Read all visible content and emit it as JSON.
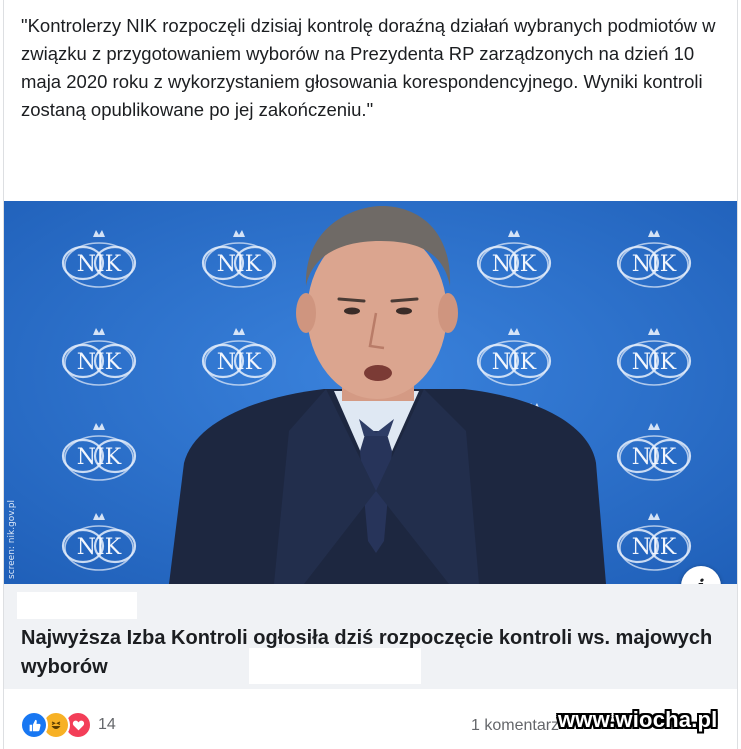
{
  "post": {
    "text": "\"Kontrolerzy NIK rozpoczęli dzisiaj kontrolę doraźną działań wybranych podmiotów w związku z przygotowaniem wyborów na Prezydenta RP zarządzonych na dzień 10 maja 2020 roku z wykorzystaniem głosowania korespondencyjnego. Wyniki kontroli zostaną opublikowane po jej zakończeniu.\""
  },
  "media": {
    "logo_text": "NIK",
    "credit": "screen: nik.gov.pl",
    "info_label": "i",
    "background_color": "#2b6fc9"
  },
  "link_preview": {
    "title": "Najwyższa Izba Kontroli ogłosiła dziś rozpoczęcie kontroli ws. majowych wyborów"
  },
  "footer": {
    "reaction_icons": [
      "like-icon",
      "haha-icon",
      "love-icon"
    ],
    "reaction_count": "14",
    "comments_label": "1 komentarz"
  },
  "watermark": {
    "text": "www.wiocha.pl"
  }
}
